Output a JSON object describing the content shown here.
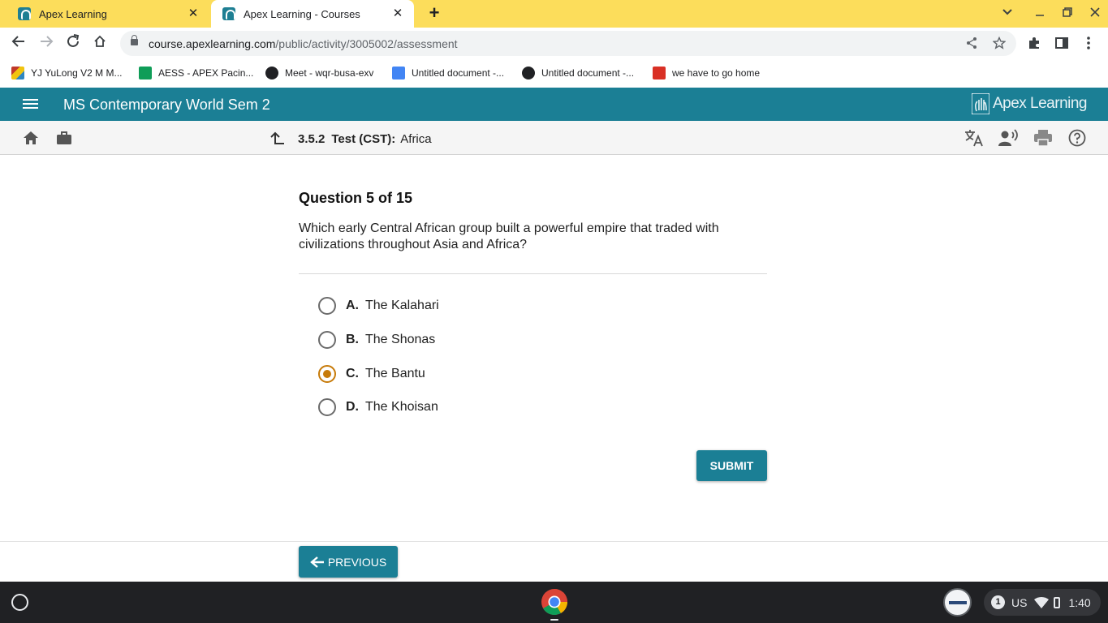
{
  "browser": {
    "tabs": [
      {
        "title": "Apex Learning",
        "active": false
      },
      {
        "title": "Apex Learning - Courses",
        "active": true
      }
    ],
    "url_host": "course.apexlearning.com",
    "url_path": "/public/activity/3005002/assessment",
    "bookmarks": [
      {
        "label": "YJ YuLong V2 M M...",
        "icon": "cube-icon",
        "color": "#c0392b"
      },
      {
        "label": "AESS - APEX Pacin...",
        "icon": "sheets-icon",
        "color": "#0f9d58"
      },
      {
        "label": "Meet - wqr-busa-exv",
        "icon": "globe-icon",
        "color": "#202124"
      },
      {
        "label": "Untitled document -...",
        "icon": "docs-icon",
        "color": "#4285f4"
      },
      {
        "label": "Untitled document -...",
        "icon": "globe-icon",
        "color": "#202124"
      },
      {
        "label": "we have to go home",
        "icon": "photo-icon",
        "color": "#d93025"
      }
    ]
  },
  "apex": {
    "course_title": "MS Contemporary World Sem 2",
    "logo_text": "Apex Learning",
    "brand_color": "#1b7f95",
    "activity_number": "3.5.2",
    "activity_type": "Test (CST):",
    "activity_name": "Africa"
  },
  "question": {
    "number_label": "Question 5 of 15",
    "text": "Which early Central African group built a powerful empire that traded with civilizations throughout Asia and Africa?",
    "choices": [
      {
        "letter": "A.",
        "text": "The Kalahari",
        "selected": false
      },
      {
        "letter": "B.",
        "text": "The Shonas",
        "selected": false
      },
      {
        "letter": "C.",
        "text": "The Bantu",
        "selected": true
      },
      {
        "letter": "D.",
        "text": "The Khoisan",
        "selected": false
      }
    ],
    "selected_color": "#c77b0a",
    "submit_label": "SUBMIT"
  },
  "footer": {
    "previous_label": "PREVIOUS"
  },
  "shelf": {
    "notification_count": "1",
    "input_method": "US",
    "time": "1:40"
  }
}
